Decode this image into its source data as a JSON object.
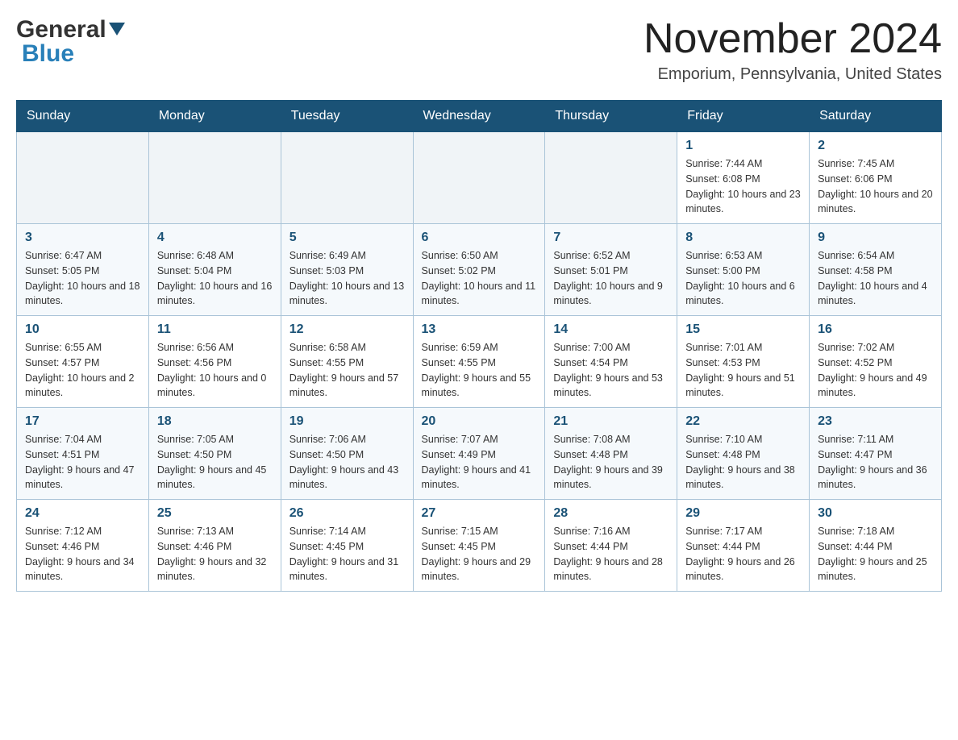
{
  "header": {
    "logo_general": "General",
    "logo_blue": "Blue",
    "month_title": "November 2024",
    "location": "Emporium, Pennsylvania, United States"
  },
  "days_of_week": [
    "Sunday",
    "Monday",
    "Tuesday",
    "Wednesday",
    "Thursday",
    "Friday",
    "Saturday"
  ],
  "weeks": [
    [
      {
        "day": "",
        "info": ""
      },
      {
        "day": "",
        "info": ""
      },
      {
        "day": "",
        "info": ""
      },
      {
        "day": "",
        "info": ""
      },
      {
        "day": "",
        "info": ""
      },
      {
        "day": "1",
        "info": "Sunrise: 7:44 AM\nSunset: 6:08 PM\nDaylight: 10 hours and 23 minutes."
      },
      {
        "day": "2",
        "info": "Sunrise: 7:45 AM\nSunset: 6:06 PM\nDaylight: 10 hours and 20 minutes."
      }
    ],
    [
      {
        "day": "3",
        "info": "Sunrise: 6:47 AM\nSunset: 5:05 PM\nDaylight: 10 hours and 18 minutes."
      },
      {
        "day": "4",
        "info": "Sunrise: 6:48 AM\nSunset: 5:04 PM\nDaylight: 10 hours and 16 minutes."
      },
      {
        "day": "5",
        "info": "Sunrise: 6:49 AM\nSunset: 5:03 PM\nDaylight: 10 hours and 13 minutes."
      },
      {
        "day": "6",
        "info": "Sunrise: 6:50 AM\nSunset: 5:02 PM\nDaylight: 10 hours and 11 minutes."
      },
      {
        "day": "7",
        "info": "Sunrise: 6:52 AM\nSunset: 5:01 PM\nDaylight: 10 hours and 9 minutes."
      },
      {
        "day": "8",
        "info": "Sunrise: 6:53 AM\nSunset: 5:00 PM\nDaylight: 10 hours and 6 minutes."
      },
      {
        "day": "9",
        "info": "Sunrise: 6:54 AM\nSunset: 4:58 PM\nDaylight: 10 hours and 4 minutes."
      }
    ],
    [
      {
        "day": "10",
        "info": "Sunrise: 6:55 AM\nSunset: 4:57 PM\nDaylight: 10 hours and 2 minutes."
      },
      {
        "day": "11",
        "info": "Sunrise: 6:56 AM\nSunset: 4:56 PM\nDaylight: 10 hours and 0 minutes."
      },
      {
        "day": "12",
        "info": "Sunrise: 6:58 AM\nSunset: 4:55 PM\nDaylight: 9 hours and 57 minutes."
      },
      {
        "day": "13",
        "info": "Sunrise: 6:59 AM\nSunset: 4:55 PM\nDaylight: 9 hours and 55 minutes."
      },
      {
        "day": "14",
        "info": "Sunrise: 7:00 AM\nSunset: 4:54 PM\nDaylight: 9 hours and 53 minutes."
      },
      {
        "day": "15",
        "info": "Sunrise: 7:01 AM\nSunset: 4:53 PM\nDaylight: 9 hours and 51 minutes."
      },
      {
        "day": "16",
        "info": "Sunrise: 7:02 AM\nSunset: 4:52 PM\nDaylight: 9 hours and 49 minutes."
      }
    ],
    [
      {
        "day": "17",
        "info": "Sunrise: 7:04 AM\nSunset: 4:51 PM\nDaylight: 9 hours and 47 minutes."
      },
      {
        "day": "18",
        "info": "Sunrise: 7:05 AM\nSunset: 4:50 PM\nDaylight: 9 hours and 45 minutes."
      },
      {
        "day": "19",
        "info": "Sunrise: 7:06 AM\nSunset: 4:50 PM\nDaylight: 9 hours and 43 minutes."
      },
      {
        "day": "20",
        "info": "Sunrise: 7:07 AM\nSunset: 4:49 PM\nDaylight: 9 hours and 41 minutes."
      },
      {
        "day": "21",
        "info": "Sunrise: 7:08 AM\nSunset: 4:48 PM\nDaylight: 9 hours and 39 minutes."
      },
      {
        "day": "22",
        "info": "Sunrise: 7:10 AM\nSunset: 4:48 PM\nDaylight: 9 hours and 38 minutes."
      },
      {
        "day": "23",
        "info": "Sunrise: 7:11 AM\nSunset: 4:47 PM\nDaylight: 9 hours and 36 minutes."
      }
    ],
    [
      {
        "day": "24",
        "info": "Sunrise: 7:12 AM\nSunset: 4:46 PM\nDaylight: 9 hours and 34 minutes."
      },
      {
        "day": "25",
        "info": "Sunrise: 7:13 AM\nSunset: 4:46 PM\nDaylight: 9 hours and 32 minutes."
      },
      {
        "day": "26",
        "info": "Sunrise: 7:14 AM\nSunset: 4:45 PM\nDaylight: 9 hours and 31 minutes."
      },
      {
        "day": "27",
        "info": "Sunrise: 7:15 AM\nSunset: 4:45 PM\nDaylight: 9 hours and 29 minutes."
      },
      {
        "day": "28",
        "info": "Sunrise: 7:16 AM\nSunset: 4:44 PM\nDaylight: 9 hours and 28 minutes."
      },
      {
        "day": "29",
        "info": "Sunrise: 7:17 AM\nSunset: 4:44 PM\nDaylight: 9 hours and 26 minutes."
      },
      {
        "day": "30",
        "info": "Sunrise: 7:18 AM\nSunset: 4:44 PM\nDaylight: 9 hours and 25 minutes."
      }
    ]
  ]
}
